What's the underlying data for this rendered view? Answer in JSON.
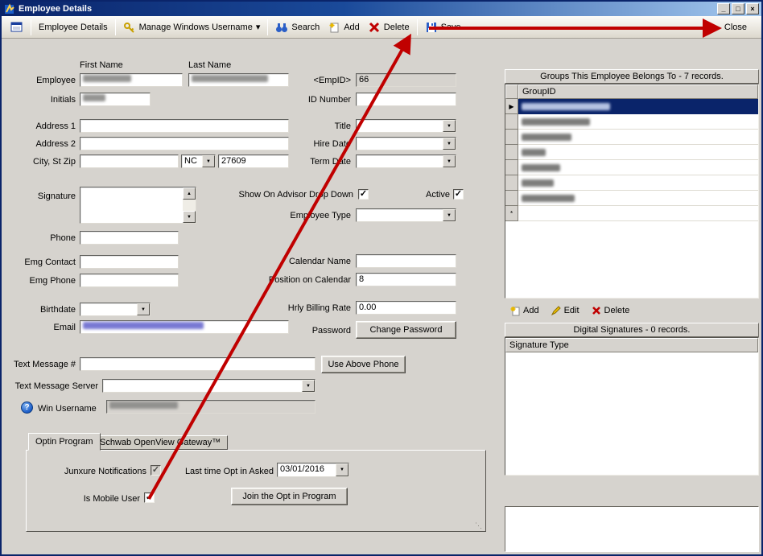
{
  "window": {
    "title": "Employee Details",
    "controls": {
      "minimize": "_",
      "maximize": "□",
      "close": "×"
    }
  },
  "icons": {
    "dropdown": "▼",
    "menu_chevron": "▾",
    "scroll_up": "▲",
    "scroll_down": "▼",
    "check": "✓",
    "current_row": "▶",
    "new_row": "*",
    "help": "?",
    "grip": "⋱"
  },
  "toolbar": {
    "employee_details": "Employee Details",
    "manage_windows_username": "Manage Windows Username",
    "search": "Search",
    "add": "Add",
    "delete": "Delete",
    "save": "Save",
    "close": "Close"
  },
  "form": {
    "first_name_label": "First Name",
    "last_name_label": "Last Name",
    "employee_label": "Employee",
    "empid_label": "<EmpID>",
    "empid_value": "66",
    "initials_label": "Initials",
    "id_number_label": "ID Number",
    "address1_label": "Address 1",
    "title_label": "Title",
    "address2_label": "Address 2",
    "hire_date_label": "Hire Date",
    "city_st_zip_label": "City, St Zip",
    "state_value": "NC",
    "zip_value": "27609",
    "term_date_label": "Term Date",
    "signature_label": "Signature",
    "show_on_advisor_label": "Show On Advisor Drop Down",
    "active_label": "Active",
    "employee_type_label": "Employee Type",
    "phone_label": "Phone",
    "calendar_name_label": "Calendar Name",
    "emg_contact_label": "Emg Contact",
    "position_on_calendar_label": "Position on Calendar",
    "position_on_calendar_value": "8",
    "emg_phone_label": "Emg Phone",
    "birthdate_label": "Birthdate",
    "hrly_billing_rate_label": "Hrly Billing Rate",
    "hrly_billing_rate_value": "0.00",
    "email_label": "Email",
    "password_label": "Password",
    "change_password_button": "Change Password",
    "text_message_number_label": "Text Message #",
    "use_above_phone_button": "Use Above Phone",
    "text_message_server_label": "Text Message Server",
    "win_username_label": "Win Username"
  },
  "tabs": {
    "optin": "Optin Program",
    "schwab": "Schwab OpenView Gateway™"
  },
  "optin": {
    "junxure_notifications_label": "Junxure Notifications",
    "last_time_opt_in_asked_label": "Last time Opt in Asked",
    "last_time_opt_in_asked_value": "03/01/2016",
    "is_mobile_user_label": "Is Mobile User",
    "join_button": "Join the Opt in Program"
  },
  "groups": {
    "header": "Groups This Employee Belongs To - 7 records.",
    "column": "GroupID",
    "add": "Add",
    "edit": "Edit",
    "delete": "Delete"
  },
  "signatures": {
    "header": "Digital Signatures - 0 records.",
    "column": "Signature Type"
  }
}
